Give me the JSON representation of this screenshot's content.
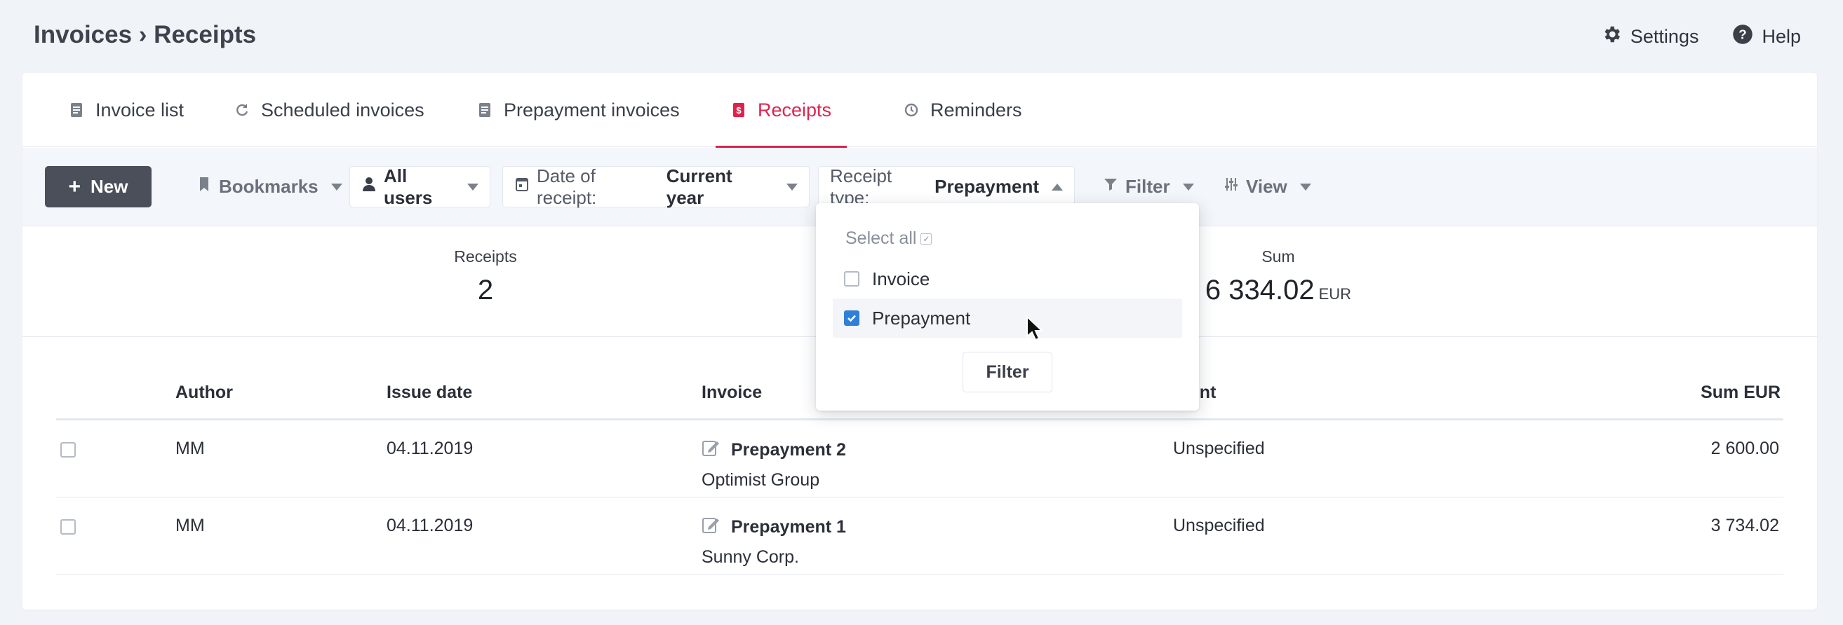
{
  "header": {
    "breadcrumb": "Invoices › Receipts",
    "settings_label": "Settings",
    "help_label": "Help"
  },
  "tabs": [
    {
      "label": "Invoice list",
      "icon": "document-icon"
    },
    {
      "label": "Scheduled invoices",
      "icon": "refresh-icon"
    },
    {
      "label": "Prepayment invoices",
      "icon": "document-icon"
    },
    {
      "label": "Receipts",
      "icon": "receipt-icon",
      "active": true
    },
    {
      "label": "Reminders",
      "icon": "clock-icon"
    }
  ],
  "toolbar": {
    "new_label": "New",
    "bookmarks_label": "Bookmarks",
    "users_label": "All users",
    "date_label": "Date of receipt:",
    "date_value": "Current year",
    "receipt_type_label": "Receipt type:",
    "receipt_type_value": "Prepayment",
    "filter_label": "Filter",
    "view_label": "View"
  },
  "stats": {
    "receipts_label": "Receipts",
    "receipts_value": "2",
    "sum_label": "Sum",
    "sum_value": "6 334.02",
    "sum_unit": "EUR"
  },
  "table": {
    "columns": [
      "Author",
      "Issue date",
      "Invoice",
      "ot account",
      "Sum EUR"
    ],
    "rows": [
      {
        "author": "MM",
        "issue_date": "04.11.2019",
        "invoice_title": "Prepayment 2",
        "invoice_client": "Optimist Group",
        "account": "Unspecified",
        "sum": "2 600.00"
      },
      {
        "author": "MM",
        "issue_date": "04.11.2019",
        "invoice_title": "Prepayment 1",
        "invoice_client": "Sunny Corp.",
        "account": "Unspecified",
        "sum": "3 734.02"
      }
    ]
  },
  "dropdown": {
    "select_all_label": "Select all",
    "options": [
      {
        "label": "Invoice",
        "checked": false
      },
      {
        "label": "Prepayment",
        "checked": true
      }
    ],
    "filter_button_label": "Filter"
  },
  "colors": {
    "accent": "#e0234b",
    "primary_button": "#4a4f59",
    "checkbox_checked": "#2f7fd6"
  }
}
